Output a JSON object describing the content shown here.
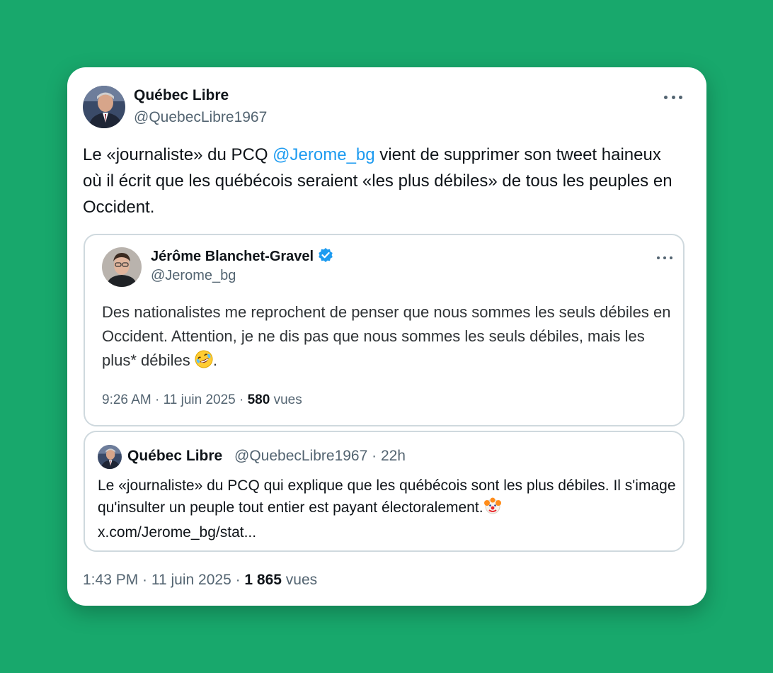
{
  "tweet": {
    "author_name": "Québec Libre",
    "author_handle": "@QuebecLibre1967",
    "text_before": "Le «journaliste» du PCQ ",
    "mention": "@Jerome_bg",
    "text_after": " vient de supprimer son tweet haineux où il écrit que les québécois seraient «les plus débiles» de tous les peuples en Occident.",
    "time": "1:43 PM · 11 juin 2025 · ",
    "views_count": "1 865",
    "views_label": " vues"
  },
  "quoted_tweet": {
    "author_name": "Jérôme Blanchet-Gravel",
    "author_handle": "@Jerome_bg",
    "text": "Des nationalistes me reprochent de penser que nous sommes les seuls débiles en Occident. Attention, je ne dis pas que nous sommes les seuls débiles, mais les plus* débiles ",
    "text_end": ".",
    "emoji": "rolling-on-floor-laughing-emoji",
    "time": "9:26 AM · 11 juin 2025 · ",
    "views_count": "580",
    "views_label": " vues"
  },
  "reply_preview": {
    "author_name": "Québec Libre",
    "author_handle": "@QuebecLibre1967 · 22h",
    "text": "Le «journaliste» du PCQ qui explique que les québécois sont les plus débiles. Il s'image qu'insulter un peuple tout entier est payant électoralement.",
    "emoji": "clown-face-emoji",
    "link": "x.com/Jerome_bg/stat..."
  },
  "colors": {
    "background": "#18a86c",
    "mention": "#1d9bf0",
    "verified": "#1d9bf0",
    "muted": "#536471",
    "text": "#0f1419",
    "border": "#cfd9de"
  }
}
